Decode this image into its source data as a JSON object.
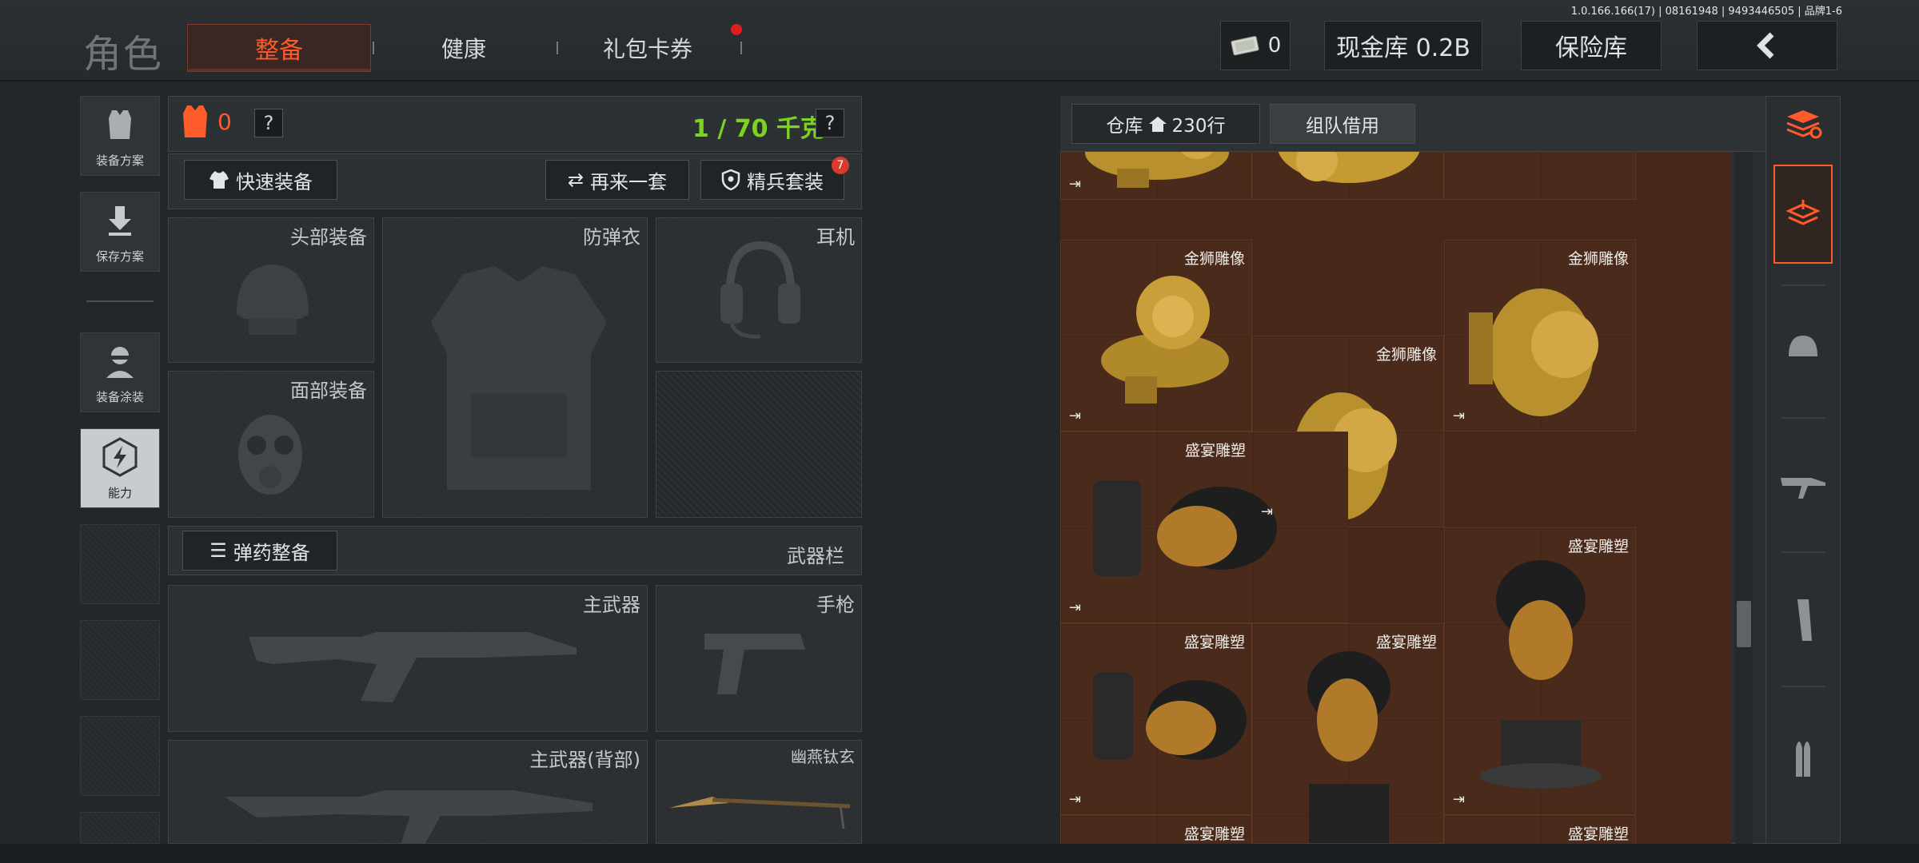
{
  "header": {
    "title": "角色",
    "tabs": [
      {
        "label": "整备",
        "active": true
      },
      {
        "label": "健康",
        "active": false
      },
      {
        "label": "礼包卡券",
        "active": false,
        "has_dot": true
      }
    ],
    "version": "1.0.166.166(17) | 08161948 | 9493446505 | 品牌1-6",
    "money": "0",
    "cash_vault": "现金库 0.2B",
    "safe_box": "保险库",
    "back_icon": "chevron-left-icon"
  },
  "sidebar": {
    "items": [
      {
        "label": "装备方案",
        "icon": "vest-icon"
      },
      {
        "label": "保存方案",
        "icon": "download-icon"
      },
      {
        "label": "装备涂装",
        "icon": "soldier-icon"
      },
      {
        "label": "能力",
        "icon": "lightning-icon",
        "selected": true
      }
    ]
  },
  "loadout": {
    "armor_count": "0",
    "weight": "1 / 70 千克",
    "help": "?",
    "quick_equip": "快速装备",
    "again_set": "再来一套",
    "elite_set": "精兵套装",
    "elite_badge": "7",
    "slots": {
      "head": "头部装备",
      "vest": "防弹衣",
      "headset": "耳机",
      "face": "面部装备"
    },
    "ammo_button": "弹药整备",
    "weapon_bar": "武器栏",
    "weapons": {
      "primary": "主武器",
      "pistol": "手枪",
      "primary_back": "主武器(背部)",
      "melee": "幽燕钛玄"
    }
  },
  "warehouse": {
    "tab_label": "仓库",
    "rows": "230行",
    "team_borrow": "组队借用",
    "items": [
      {
        "name": "",
        "kind": "lion"
      },
      {
        "name": "",
        "kind": "lion"
      },
      {
        "name": "",
        "kind": "lion"
      },
      {
        "name": "金狮雕像",
        "kind": "lion"
      },
      {
        "name": "金狮雕像",
        "kind": "lion"
      },
      {
        "name": "金狮雕像",
        "kind": "lion"
      },
      {
        "name": "盛宴雕塑",
        "kind": "bust"
      },
      {
        "name": "盛宴雕塑",
        "kind": "bust"
      },
      {
        "name": "盛宴雕塑",
        "kind": "bust"
      },
      {
        "name": "盛宴雕塑",
        "kind": "bust"
      },
      {
        "name": "盛宴雕塑",
        "kind": "bust"
      },
      {
        "name": "盛宴雕塑",
        "kind": "bust"
      }
    ]
  },
  "right_toolbar": [
    "stack-refresh-icon",
    "layers-icon",
    "helmet-icon",
    "rifle-icon",
    "magazine-icon",
    "ammo-icon"
  ]
}
